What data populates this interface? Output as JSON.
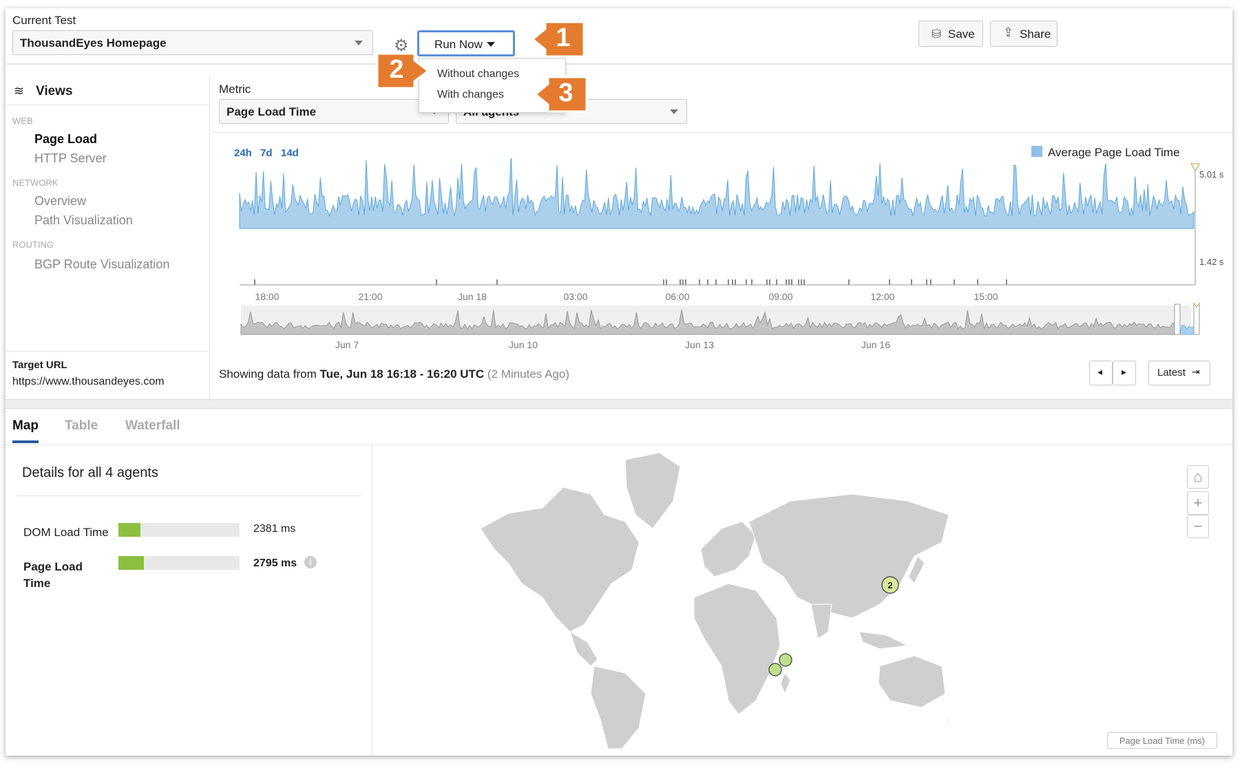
{
  "top_bar": {
    "current_test_label": "Current Test",
    "current_test_value": "ThousandEyes Homepage",
    "run_now_label": "Run Now",
    "run_menu": [
      "Without changes",
      "With changes"
    ],
    "save_label": "Save",
    "share_label": "Share"
  },
  "sidebar": {
    "title": "Views",
    "sections": [
      {
        "header": "WEB",
        "items": [
          "Page Load",
          "HTTP Server"
        ]
      },
      {
        "header": "NETWORK",
        "items": [
          "Overview",
          "Path Visualization"
        ]
      },
      {
        "header": "ROUTING",
        "items": [
          "BGP Route Visualization"
        ]
      }
    ],
    "active_item": "Page Load",
    "target_url_label": "Target URL",
    "target_url": "https://www.thousandeyes.com"
  },
  "metric": {
    "label": "Metric",
    "value": "Page Load Time",
    "agents_value": "All agents"
  },
  "time_ranges": [
    "24h",
    "7d",
    "14d"
  ],
  "chart_data": {
    "type": "area",
    "title": "",
    "series": [
      {
        "name": "Average Page Load Time"
      }
    ],
    "y_labels": [
      "5.01 s",
      "1.42 s"
    ],
    "x_ticks": [
      "18:00",
      "21:00",
      "Jun 18",
      "03:00",
      "06:00",
      "09:00",
      "12:00",
      "15:00"
    ],
    "overview_ticks": [
      "Jun 7",
      "Jun 10",
      "Jun 13",
      "Jun 16"
    ],
    "colors": {
      "main": "#8fc0e6",
      "overview": "#c8c8c8"
    }
  },
  "status": {
    "prefix": "Showing data from ",
    "range": "Tue, Jun 18 16:18 - 16:20 UTC",
    "ago": "(2 Minutes Ago)",
    "latest_label": "Latest"
  },
  "tabs": [
    "Map",
    "Table",
    "Waterfall"
  ],
  "details": {
    "title": "Details for all 4 agents",
    "rows": [
      {
        "label": "DOM Load Time",
        "value": "2381 ms",
        "fill": 0.18
      },
      {
        "label": "Page Load Time",
        "value": "2795 ms",
        "fill": 0.21
      }
    ]
  },
  "map": {
    "cluster_count": "2",
    "legend": "Page Load Time (ms)"
  },
  "callouts": [
    "1",
    "2",
    "3"
  ],
  "colors": {
    "accent": "#2a6bb5",
    "callout": "#e47b2f",
    "bar": "#8cbf3f",
    "agent": "#bfe08a"
  }
}
